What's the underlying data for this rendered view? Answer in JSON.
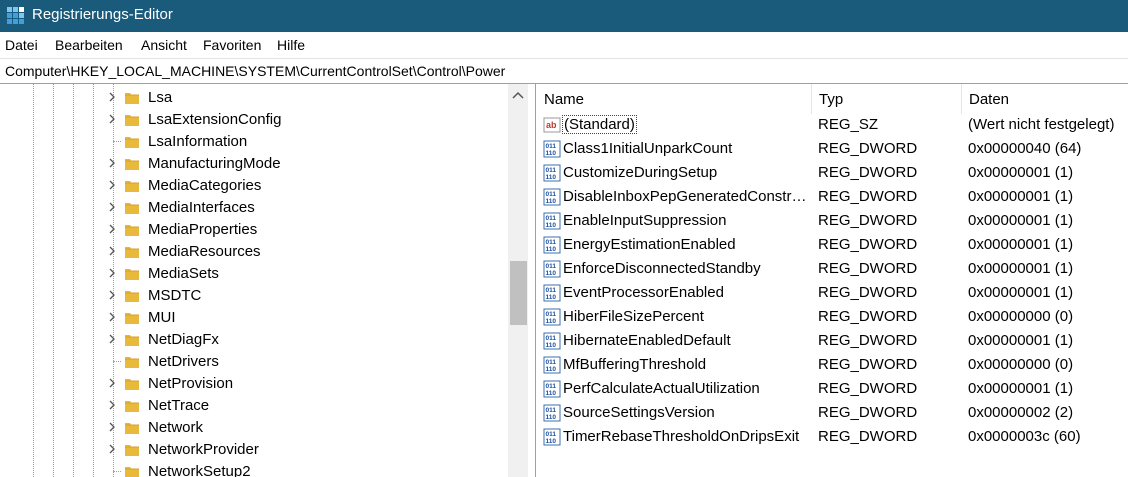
{
  "window": {
    "title": "Registrierungs-Editor",
    "app_icon": "regedit-icon"
  },
  "menu": [
    "Datei",
    "Bearbeiten",
    "Ansicht",
    "Favoriten",
    "Hilfe"
  ],
  "address": "Computer\\HKEY_LOCAL_MACHINE\\SYSTEM\\CurrentControlSet\\Control\\Power",
  "tree": {
    "items": [
      {
        "label": "Lsa",
        "expandable": true
      },
      {
        "label": "LsaExtensionConfig",
        "expandable": true
      },
      {
        "label": "LsaInformation",
        "expandable": false
      },
      {
        "label": "ManufacturingMode",
        "expandable": true
      },
      {
        "label": "MediaCategories",
        "expandable": true
      },
      {
        "label": "MediaInterfaces",
        "expandable": true
      },
      {
        "label": "MediaProperties",
        "expandable": true
      },
      {
        "label": "MediaResources",
        "expandable": true
      },
      {
        "label": "MediaSets",
        "expandable": true
      },
      {
        "label": "MSDTC",
        "expandable": true
      },
      {
        "label": "MUI",
        "expandable": true
      },
      {
        "label": "NetDiagFx",
        "expandable": true
      },
      {
        "label": "NetDrivers",
        "expandable": false
      },
      {
        "label": "NetProvision",
        "expandable": true
      },
      {
        "label": "NetTrace",
        "expandable": true
      },
      {
        "label": "Network",
        "expandable": true
      },
      {
        "label": "NetworkProvider",
        "expandable": true
      },
      {
        "label": "NetworkSetup2",
        "expandable": false
      }
    ]
  },
  "list": {
    "headers": {
      "name": "Name",
      "type": "Typ",
      "data": "Daten"
    },
    "rows": [
      {
        "icon": "string-value-icon",
        "name": "(Standard)",
        "type": "REG_SZ",
        "data": "(Wert nicht festgelegt)"
      },
      {
        "icon": "binary-value-icon",
        "name": "Class1InitialUnparkCount",
        "type": "REG_DWORD",
        "data": "0x00000040 (64)"
      },
      {
        "icon": "binary-value-icon",
        "name": "CustomizeDuringSetup",
        "type": "REG_DWORD",
        "data": "0x00000001 (1)"
      },
      {
        "icon": "binary-value-icon",
        "name": "DisableInboxPepGeneratedConstrai...",
        "type": "REG_DWORD",
        "data": "0x00000001 (1)"
      },
      {
        "icon": "binary-value-icon",
        "name": "EnableInputSuppression",
        "type": "REG_DWORD",
        "data": "0x00000001 (1)"
      },
      {
        "icon": "binary-value-icon",
        "name": "EnergyEstimationEnabled",
        "type": "REG_DWORD",
        "data": "0x00000001 (1)"
      },
      {
        "icon": "binary-value-icon",
        "name": "EnforceDisconnectedStandby",
        "type": "REG_DWORD",
        "data": "0x00000001 (1)"
      },
      {
        "icon": "binary-value-icon",
        "name": "EventProcessorEnabled",
        "type": "REG_DWORD",
        "data": "0x00000001 (1)"
      },
      {
        "icon": "binary-value-icon",
        "name": "HiberFileSizePercent",
        "type": "REG_DWORD",
        "data": "0x00000000 (0)"
      },
      {
        "icon": "binary-value-icon",
        "name": "HibernateEnabledDefault",
        "type": "REG_DWORD",
        "data": "0x00000001 (1)"
      },
      {
        "icon": "binary-value-icon",
        "name": "MfBufferingThreshold",
        "type": "REG_DWORD",
        "data": "0x00000000 (0)"
      },
      {
        "icon": "binary-value-icon",
        "name": "PerfCalculateActualUtilization",
        "type": "REG_DWORD",
        "data": "0x00000001 (1)"
      },
      {
        "icon": "binary-value-icon",
        "name": "SourceSettingsVersion",
        "type": "REG_DWORD",
        "data": "0x00000002 (2)"
      },
      {
        "icon": "binary-value-icon",
        "name": "TimerRebaseThresholdOnDripsExit",
        "type": "REG_DWORD",
        "data": "0x0000003c (60)"
      }
    ]
  },
  "colors": {
    "titlebar": "#1a5a7a",
    "folder": "#e8b93a",
    "scroll_thumb": "#c0c0c0"
  }
}
